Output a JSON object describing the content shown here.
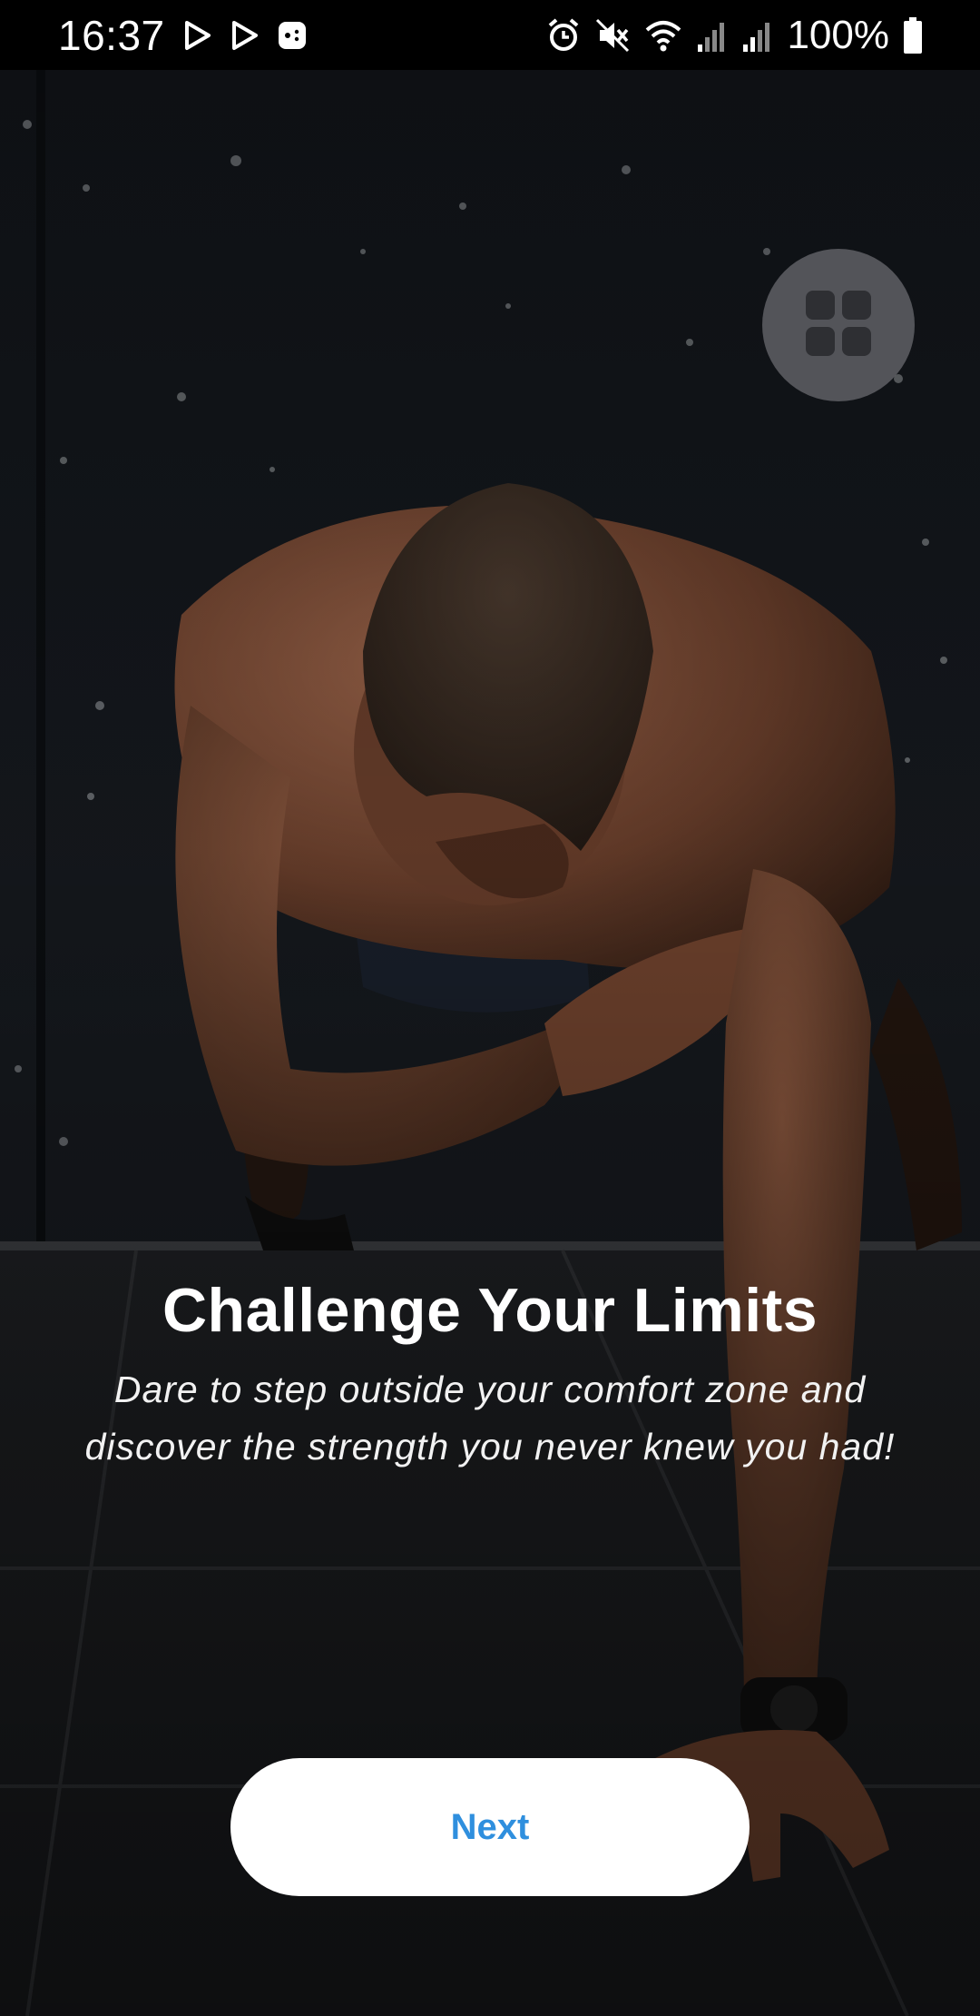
{
  "status_bar": {
    "time": "16:37",
    "battery_percent": "100%",
    "icons_left": [
      "play-store-icon",
      "play-store-icon",
      "game-controller-icon"
    ],
    "icons_right": [
      "alarm-icon",
      "mute-icon",
      "wifi-icon",
      "signal-icon",
      "signal-icon",
      "battery-icon"
    ]
  },
  "background": {
    "description_icon": "workout-photo"
  },
  "menu_button": {
    "icon": "grid-icon"
  },
  "onboarding": {
    "title": "Challenge Your Limits",
    "subtitle_line1": "Dare to step outside your comfort zone and",
    "subtitle_line2": "discover the strength you never knew you had!"
  },
  "actions": {
    "next_label": "Next"
  },
  "colors": {
    "accent": "#2f8fde",
    "button_bg": "#ffffff",
    "status_bar_bg": "#000000"
  }
}
